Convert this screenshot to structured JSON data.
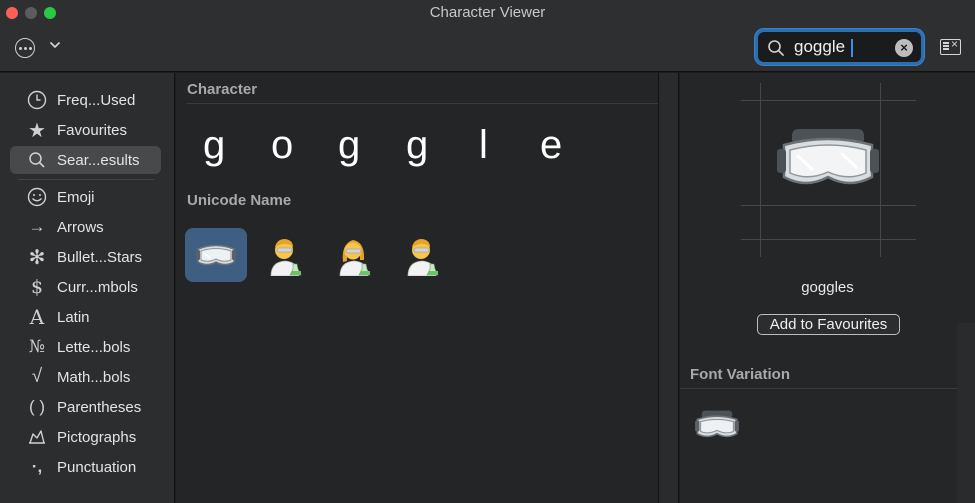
{
  "window": {
    "title": "Character Viewer"
  },
  "toolbar": {
    "action_icon": "ellipsis-circle-icon",
    "search": {
      "value": "goggle",
      "placeholder": "Search"
    },
    "clear_icon": "clear-circle-icon",
    "view_toggle_icon": "character-palette-icon"
  },
  "sidebar": {
    "items": [
      {
        "label": "Freq...Used",
        "icon": "clock-icon"
      },
      {
        "label": "Favourites",
        "icon": "star-icon"
      },
      {
        "label": "Sear...esults",
        "icon": "search-icon",
        "selected": true
      },
      {
        "label": "Emoji",
        "icon": "smiley-icon"
      },
      {
        "label": "Arrows",
        "icon": "arrow-icon"
      },
      {
        "label": "Bullet...Stars",
        "icon": "asterisk-icon"
      },
      {
        "label": "Curr...mbols",
        "icon": "dollar-icon"
      },
      {
        "label": "Latin",
        "icon": "latin-a-icon"
      },
      {
        "label": "Lette...bols",
        "icon": "numero-icon"
      },
      {
        "label": "Math...bols",
        "icon": "square-root-icon"
      },
      {
        "label": "Parentheses",
        "icon": "parentheses-icon"
      },
      {
        "label": "Pictographs",
        "icon": "pictograph-icon"
      },
      {
        "label": "Punctuation",
        "icon": "punctuation-icon"
      }
    ]
  },
  "main": {
    "character_section": "Character",
    "characters": [
      "g",
      "o",
      "g",
      "g",
      "l",
      "e"
    ],
    "unicode_section": "Unicode Name",
    "results": [
      {
        "name": "goggles-icon",
        "selected": true
      },
      {
        "name": "man-scientist-icon"
      },
      {
        "name": "woman-scientist-icon"
      },
      {
        "name": "man-scientist-icon"
      }
    ]
  },
  "detail": {
    "name": "goggles",
    "add_button": "Add to Favourites",
    "font_variation_title": "Font Variation"
  },
  "colors": {
    "accent": "#2a6fb2",
    "selection": "#3f5f82",
    "close": "#fe5f57",
    "zoom": "#29c941"
  }
}
